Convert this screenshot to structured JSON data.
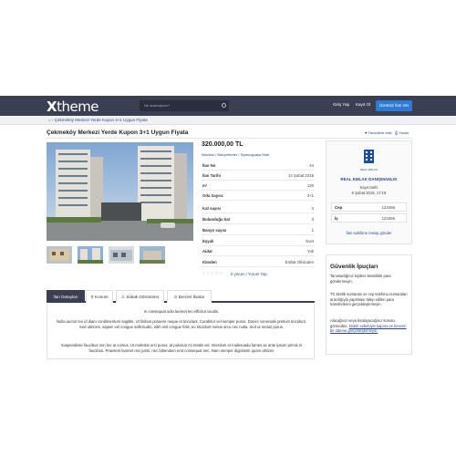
{
  "header": {
    "logo_bold": "X",
    "logo_rest": "theme",
    "search_placeholder": "Ne aramıştınız?",
    "login": "Giriş Yap",
    "register": "Kayıt Ol",
    "post_ad": "Ücretsiz İlan Ver"
  },
  "breadcrumb": {
    "home_icon": "home-icon",
    "separator": "›",
    "text": "Çekmeköy Merkezi Yerde Kupon 3+1 Uygun Fiyata"
  },
  "listing": {
    "title": "Çekmeköy Merkezi Yerde Kupon 3+1 Uygun Fiyata",
    "favorite": "♥ Favorilere ekle",
    "print": "⎙ Yazdır",
    "price": "320.000,00 TL",
    "location": "İstanbul / Bahçelievler / Siyavuşpaşa Mah.",
    "details": [
      {
        "k": "İlan No",
        "v": "44"
      },
      {
        "k": "İlan Tarihi",
        "v": "14 Şubat 2018"
      },
      {
        "k": "m²",
        "v": "120"
      },
      {
        "k": "Oda Sayısı:",
        "v": "3+1"
      },
      {
        "k": "Kat sayısı",
        "v": "4"
      },
      {
        "k": "Bulunduğu kat",
        "v": "3"
      },
      {
        "k": "Banyo sayısı",
        "v": "1"
      },
      {
        "k": "Eşyalı",
        "v": "Evet"
      },
      {
        "k": "Aidat",
        "v": "Yok"
      },
      {
        "k": "Kimden",
        "v": "Emlak Ofisinden"
      }
    ],
    "stars": "☆☆☆☆☆",
    "rating_text": "0 yorum / Yorum Yap"
  },
  "agent": {
    "logo_text": "REAL EMLAK",
    "name": "REAL EMLAK DANIŞMANLIK",
    "registered_label": "Kayıt tarihi",
    "registered_date": "9 Şubat 2018, 17:19",
    "phone_label": "Cep",
    "phone": "123456",
    "work_label": "İş",
    "work": "123456",
    "message_link": "İlan sahibine mesaj gönder"
  },
  "safety": {
    "title": "Güvenlik İpuçları",
    "p1": "Tanımadığınız kişilere kesinlikle para göndermeyin.",
    "p2": "TC kimlik numarası ve cep telefonu numaraları aracılığıyla yapılması talep edilen para transferlerini gerçekleştirmeyin.",
    "p3_pre": "Alacağınız veya kiralayacağınız konutu görmeden, ",
    "p3_link": "kiralık sebebiyle kapora ve benzeri bir ödeme gerçekleştirmeyin."
  },
  "tabs": [
    {
      "label": "İlan Detayları"
    },
    {
      "label": "⚲ Konum"
    },
    {
      "label": "♙ Sokak Görünümü"
    },
    {
      "label": "⊙ Benzer İlanlar"
    }
  ],
  "description": {
    "p1": "In consequat odio laoreet leo efficitur iaculis.",
    "p2": "Nulla auctor leo id diam condimentum sagittis. Ut finibus posuere neque et tincidunt. Curabitur vel semper purus. Donec venenatis pretium tincidunt. Sed ultricies, sapien vel congue sollicitudin, nibh nisl congue felis, eu tincidunt metus arcu nec nulla. Sed ut metus purus.",
    "p3": "Suspendisse faucibus non leo at cursus. Ut molestie orci purus, at pulvinar mi mattis vel. Interdum et malesuada fames ac ante ipsum primis in faucibus. Praesent laoreet orci justo, nec bibendum erat consequat nec. Nam semper dignissim quam ultrices"
  }
}
